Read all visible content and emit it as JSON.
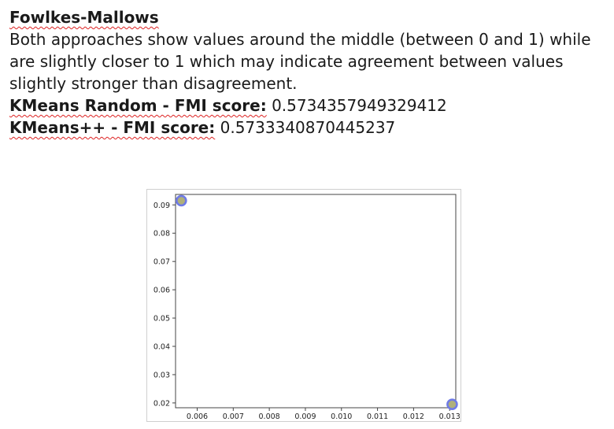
{
  "document": {
    "heading": "Fowlkes-Mallows",
    "paragraph": "Both approaches show values around the middle (between 0 and 1) while are slightly closer to 1 which may indicate agreement between values slightly stronger than disagreement.",
    "scores": [
      {
        "label": "KMeans Random - FMI score:",
        "value": "0.5734357949329412"
      },
      {
        "label": "KMeans++ - FMI score:",
        "value": "0.5733340870445237"
      }
    ]
  },
  "chart_data": {
    "type": "scatter",
    "x": [
      0.00556,
      0.01307
    ],
    "y": [
      0.0915,
      0.0195
    ],
    "xlim": [
      0.0054,
      0.01317
    ],
    "ylim": [
      0.0183,
      0.0937
    ],
    "xticks": [
      "0.006",
      "0.007",
      "0.008",
      "0.009",
      "0.010",
      "0.011",
      "0.012",
      "0.013"
    ],
    "xtick_values": [
      0.006,
      0.007,
      0.008,
      0.009,
      0.01,
      0.011,
      0.012,
      0.013
    ],
    "yticks": [
      "0.02",
      "0.03",
      "0.04",
      "0.05",
      "0.06",
      "0.07",
      "0.08",
      "0.09"
    ],
    "ytick_values": [
      0.02,
      0.03,
      0.04,
      0.05,
      0.06,
      0.07,
      0.08,
      0.09
    ],
    "grid": false,
    "marker_edge_color": "#6f7be6",
    "marker_face_color": "#b0b07a"
  }
}
